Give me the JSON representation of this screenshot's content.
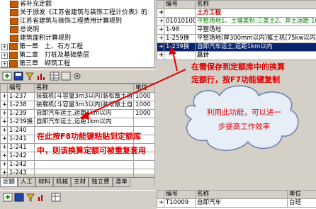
{
  "tree": {
    "items": [
      {
        "label": "省补充定额",
        "indent": 1,
        "type": "book"
      },
      {
        "label": "关于颁发《江苏省建筑与装饰工程计价表》的",
        "indent": 1,
        "type": "book"
      },
      {
        "label": "江苏省建筑与装饰工程费用计算规则",
        "indent": 1,
        "type": "book"
      },
      {
        "label": "总说明",
        "indent": 1,
        "type": "book"
      },
      {
        "label": "建筑面积计算规则",
        "indent": 1,
        "type": "book"
      },
      {
        "label": "第一章　土、石方工程",
        "indent": 0,
        "type": "folder"
      },
      {
        "label": "第二章　打桩及基础垫层",
        "indent": 0,
        "type": "folder"
      },
      {
        "label": "第三章　砌筑工程",
        "indent": 0,
        "type": "folder"
      },
      {
        "label": "第四章　钢筋工程",
        "indent": 0,
        "type": "folder"
      }
    ]
  },
  "left_grid": {
    "headers": [
      "编号",
      "名称",
      "单位"
    ],
    "rows": [
      {
        "code": "1-237",
        "name": "装载机(斗容量3m3以内)装松散土自",
        "unit": "1000"
      },
      {
        "code": "1-238",
        "name": "装载机(斗容量3m3以内)装松散土自",
        "unit": "1000"
      },
      {
        "code": "1-239",
        "name": "自卸汽车运土,运距1km以内",
        "unit": "1000"
      },
      {
        "code": "1-239换",
        "name": "自卸汽车运土,运距1km以内",
        "unit": ""
      },
      {
        "code": "1-240",
        "name": "",
        "unit": ""
      },
      {
        "code": "1-241",
        "name": "",
        "unit": ""
      },
      {
        "code": "1-241",
        "name": "",
        "unit": ""
      },
      {
        "code": "1-242",
        "name": "",
        "unit": ""
      },
      {
        "code": "1-242",
        "name": "",
        "unit": ""
      },
      {
        "code": "1-243",
        "name": "",
        "unit": ""
      },
      {
        "code": "1-244",
        "name": "",
        "unit": ""
      }
    ]
  },
  "tabs": [
    "定额",
    "人工",
    "材料",
    "机械",
    "主材",
    "独立费",
    "清单"
  ],
  "right_grid": {
    "headers": [
      "编号",
      "名称"
    ],
    "rows": [
      {
        "code": "",
        "name": "土方工程",
        "style": "section"
      },
      {
        "code": "010101001",
        "name": "平整场地1、土壤类别:三类土2、弃土运距:100",
        "style": "green"
      },
      {
        "code": "1-98",
        "name": "平整场地",
        "style": ""
      },
      {
        "code": "1-259换",
        "name": "平整场地(厚300mm以内)推土机(75kw以内)",
        "style": ""
      },
      {
        "code": "1-239换",
        "name": "自卸汽车运土,运距1km以内",
        "style": "selected"
      },
      {
        "code": "",
        "name": "总计",
        "style": "bold"
      }
    ]
  },
  "bottom_grid": {
    "headers": [
      "编号",
      "名称",
      "单位"
    ],
    "rows": [
      {
        "code": "T10009",
        "name": "自卸汽车",
        "unit": "台班"
      }
    ]
  },
  "annotations": {
    "top_right_line1": "在需保存到定额库中的换算",
    "top_right_line2": "定额行，按F7功能键复制",
    "left_line1": "在此按F8功能键粘贴到定额库",
    "left_line2": "中，则该换算定额可被重复套用",
    "cloud_line1": "利用此功能，可以进一",
    "cloud_line2": "步提高工作效率"
  },
  "colors": {
    "annotation": "#e00000",
    "selection": "#0a246a",
    "cloud_fill": "#e8eef8",
    "cloud_stroke": "#6a7fb0"
  }
}
